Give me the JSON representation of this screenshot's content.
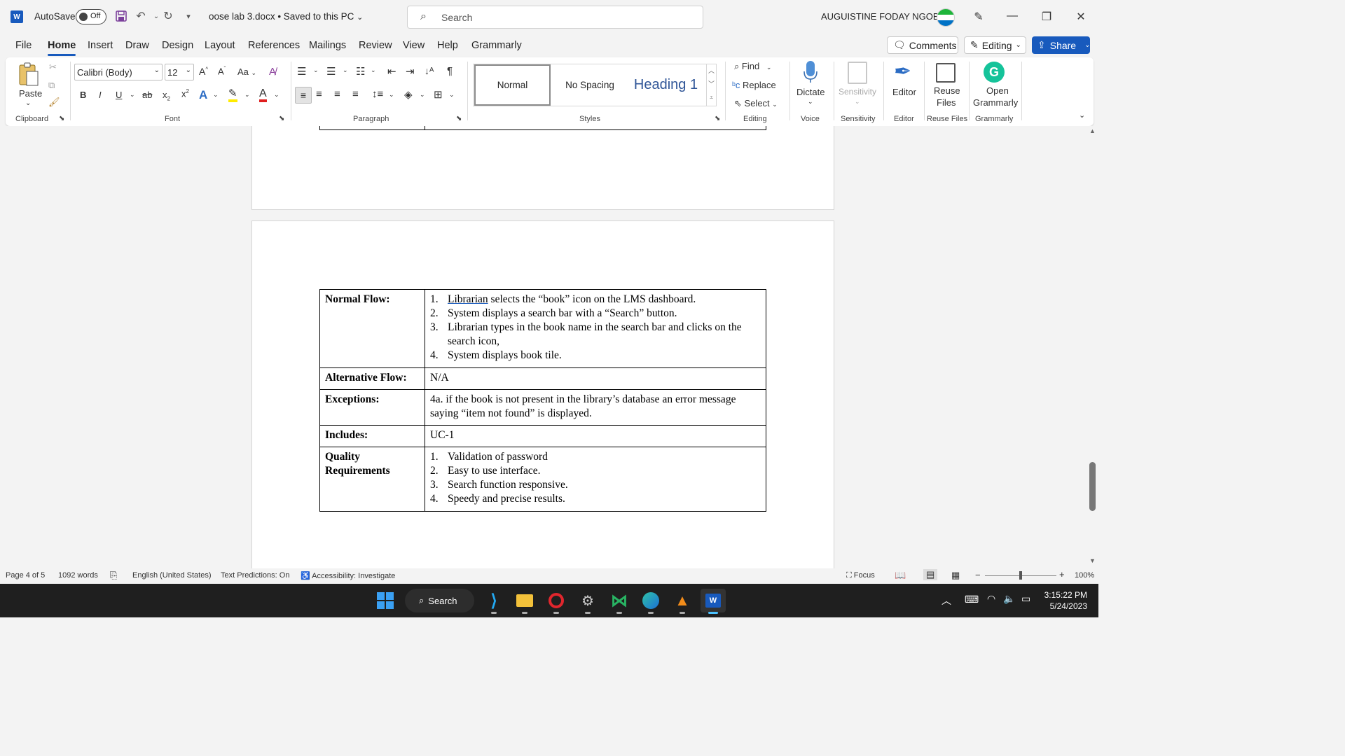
{
  "titlebar": {
    "app_icon": "word-logo",
    "autosave_label": "AutoSave",
    "autosave_state": "Off",
    "doc_title": "oose lab 3.docx • Saved to this PC",
    "search_placeholder": "Search",
    "user_name": "AUGUISTINE FODAY NGOBIE"
  },
  "menu": {
    "tabs": [
      "File",
      "Home",
      "Insert",
      "Draw",
      "Design",
      "Layout",
      "References",
      "Mailings",
      "Review",
      "View",
      "Help",
      "Grammarly"
    ],
    "active_tab": "Home",
    "comments_label": "Comments",
    "editing_label": "Editing",
    "share_label": "Share"
  },
  "ribbon": {
    "clipboard": {
      "paste_label": "Paste",
      "group_label": "Clipboard"
    },
    "font": {
      "font_name": "Calibri (Body)",
      "font_size": "12",
      "group_label": "Font",
      "change_case": "Aa"
    },
    "paragraph": {
      "group_label": "Paragraph"
    },
    "styles": {
      "items": [
        "Normal",
        "No Spacing",
        "Heading 1"
      ],
      "selected": "Normal",
      "group_label": "Styles"
    },
    "editing": {
      "find": "Find",
      "replace": "Replace",
      "select": "Select",
      "group_label": "Editing"
    },
    "voice": {
      "dictate": "Dictate",
      "group_label": "Voice"
    },
    "sensitivity": {
      "label": "Sensitivity",
      "group_label": "Sensitivity"
    },
    "editor": {
      "label": "Editor",
      "group_label": "Editor"
    },
    "reuse": {
      "label1": "Reuse",
      "label2": "Files",
      "group_label": "Reuse Files"
    },
    "grammarly": {
      "label1": "Open",
      "label2": "Grammarly",
      "group_label": "Grammarly"
    }
  },
  "document": {
    "table": {
      "normal_flow": {
        "label": "Normal Flow:",
        "steps": [
          {
            "n": "1.",
            "pre": "",
            "underlined": "Librarian",
            "text": " selects the “book” icon on the LMS dashboard."
          },
          {
            "n": "2.",
            "pre": "",
            "underlined": "",
            "text": "System displays a search bar with a “Search” button."
          },
          {
            "n": "3.",
            "pre": "",
            "underlined": "",
            "text": "Librarian types in the book name in the search bar and clicks on the search icon,"
          },
          {
            "n": "4.",
            "pre": "",
            "underlined": "",
            "text": "System displays book tile."
          }
        ]
      },
      "alternative_flow": {
        "label": "Alternative Flow:",
        "value": "N/A"
      },
      "exceptions": {
        "label": "Exceptions:",
        "value": "4a. if the book is not present in the library’s database an error message saying “item not found” is displayed."
      },
      "includes": {
        "label": "Includes:",
        "value": "UC-1"
      },
      "quality": {
        "label": "Quality Requirements",
        "items": [
          {
            "n": "1.",
            "text": "Validation of password"
          },
          {
            "n": "2.",
            "text": "Easy to use interface."
          },
          {
            "n": "3.",
            "text": "Search function responsive."
          },
          {
            "n": "4.",
            "text": "Speedy and precise results."
          }
        ]
      }
    }
  },
  "statusbar": {
    "page": "Page 4 of 5",
    "words": "1092 words",
    "language": "English (United States)",
    "predictions": "Text Predictions: On",
    "accessibility": "Accessibility: Investigate",
    "focus": "Focus",
    "zoom": "100%",
    "zoom_minus": "−",
    "zoom_plus": "+"
  },
  "taskbar": {
    "search_label": "Search",
    "time": "3:15:22 PM",
    "date": "5/24/2023",
    "apps": [
      "start-icon",
      "vscode-icon",
      "file-explorer-icon",
      "opera-icon",
      "chatgpt-icon",
      "visual-studio-icon",
      "edge-icon",
      "vlc-icon",
      "word-icon"
    ]
  }
}
